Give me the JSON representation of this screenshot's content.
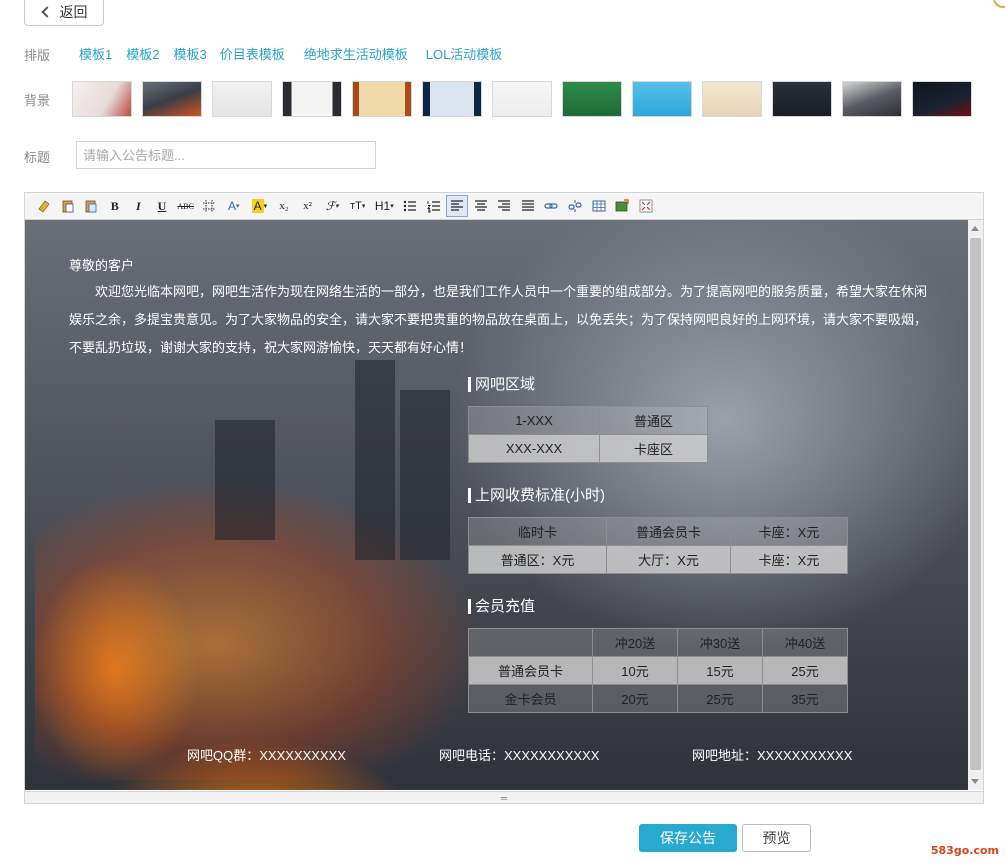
{
  "nav": {
    "back_label": "返回"
  },
  "layout_row": {
    "label": "排版",
    "templates": [
      "模板1",
      "模板2",
      "模板3",
      "价目表模板",
      "绝地求生活动模板",
      "LOL活动模板"
    ]
  },
  "background_row": {
    "label": "背景",
    "thumbnail_count": 13
  },
  "title_row": {
    "label": "标题",
    "placeholder": "请输入公告标题...",
    "value": ""
  },
  "toolbar": {
    "tools": [
      "eraser-icon",
      "paste-icon",
      "paste-plain-icon",
      "bold-icon",
      "italic-icon",
      "underline-icon",
      "strikethrough-icon",
      "grid-icon",
      "font-color-icon",
      "highlight-icon",
      "subscript-icon",
      "superscript-icon",
      "font-family-icon",
      "font-size-icon",
      "heading-icon",
      "bullet-list-icon",
      "numbered-list-icon",
      "align-left-icon",
      "align-center-icon",
      "align-right-icon",
      "justify-icon",
      "link-icon",
      "unlink-icon",
      "table-icon",
      "insert-image-icon",
      "fullscreen-icon"
    ],
    "labels": {
      "bold": "B",
      "italic": "I",
      "underline": "U",
      "strike": "ABC",
      "font_color": "A",
      "highlight": "A",
      "subscript": "x₂",
      "superscript": "x²",
      "font_family": "ℱ",
      "font_size": "тT",
      "heading": "H1"
    }
  },
  "notice": {
    "greeting": "尊敬的客户",
    "body": "欢迎您光临本网吧，网吧生活作为现在网络生活的一部分，也是我们工作人员中一个重要的组成部分。为了提高网吧的服务质量，希望大家在休闲娱乐之余，多提宝贵意见。为了大家物品的安全，请大家不要把贵重的物品放在桌面上，以免丢失；为了保持网吧良好的上网环境，请大家不要吸烟，不要乱扔垃圾，谢谢大家的支持，祝大家网游愉快，天天都有好心情！",
    "area_title": "网吧区域",
    "area_rows": [
      [
        "1-XXX",
        "普通区"
      ],
      [
        "XXX-XXX",
        "卡座区"
      ]
    ],
    "fee_title": "上网收费标准(小时)",
    "fee_header": [
      "临时卡",
      "普通会员卡",
      "卡座：X元"
    ],
    "fee_row": [
      "普通区：X元",
      "大厅：X元",
      "卡座：X元"
    ],
    "recharge_title": "会员充值",
    "recharge_header": [
      "",
      "冲20送",
      "冲30送",
      "冲40送"
    ],
    "recharge_rows": [
      [
        "普通会员卡",
        "10元",
        "15元",
        "25元"
      ],
      [
        "金卡会员",
        "20元",
        "25元",
        "35元"
      ]
    ],
    "footer": {
      "qq": "网吧QQ群：XXXXXXXXXX",
      "phone": "网吧电话：XXXXXXXXXXX",
      "address": "网吧地址：XXXXXXXXXXX"
    }
  },
  "actions": {
    "save_label": "保存公告",
    "preview_label": "预览"
  },
  "watermark": "583go.com",
  "colors": {
    "accent": "#28a9cf",
    "link": "#2aa3c9"
  }
}
